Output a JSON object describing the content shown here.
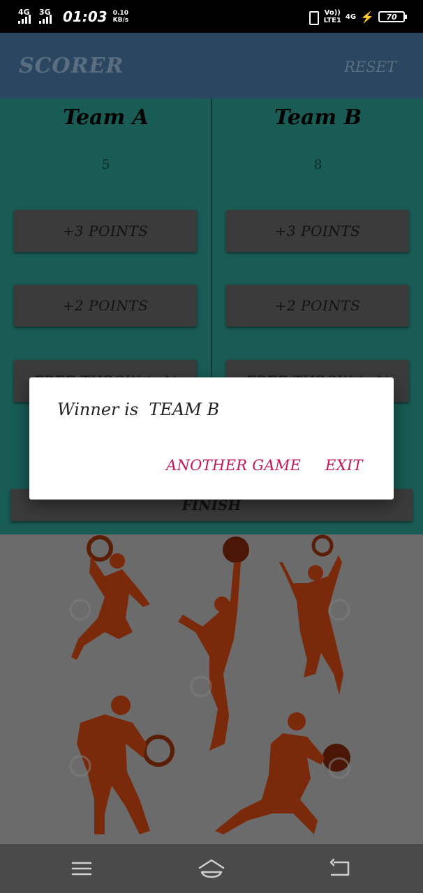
{
  "status_bar": {
    "sim1_network": "4G",
    "sim2_network": "3G",
    "time": "01:03",
    "speed_value": "0.10",
    "speed_unit": "KB/s",
    "volte_label": "Vo))",
    "lte_label": "LTE1",
    "network_right": "4G",
    "battery_level": "70"
  },
  "app_bar": {
    "title": "SCORER",
    "reset_label": "RESET"
  },
  "teams": [
    {
      "name": "Team A",
      "score": "5",
      "buttons": [
        "+3 POINTS",
        "+2 POINTS",
        "FREE THROW (+1)"
      ]
    },
    {
      "name": "Team B",
      "score": "8",
      "buttons": [
        "+3 POINTS",
        "+2 POINTS",
        "FREE THROW (+1)"
      ]
    }
  ],
  "finish_label": "FINISH",
  "dialog": {
    "message": "Winner is  TEAM B",
    "another_game_label": "ANOTHER GAME",
    "exit_label": "EXIT"
  },
  "colors": {
    "accent": "#c2185b",
    "header": "#2b4660",
    "teal": "#195c55"
  },
  "navigation": {
    "icons": [
      "menu-icon",
      "home-icon",
      "back-icon"
    ]
  }
}
